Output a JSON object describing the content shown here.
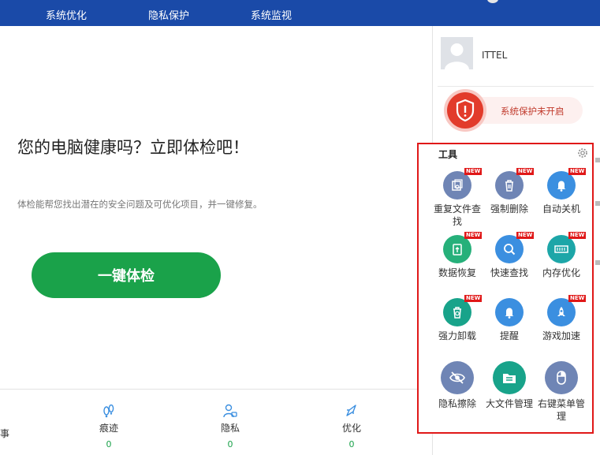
{
  "nav": {
    "tabs": [
      "系统优化",
      "隐私保护",
      "系统监视"
    ]
  },
  "main": {
    "headline": "您的电脑健康吗？立即体检吧！",
    "subtext": "体检能帮您找出潜在的安全问题及可优化项目，并一键修复。",
    "check_button": "一键体检",
    "stats": [
      {
        "label": "痕迹",
        "value": "0",
        "icon": "footprints-icon"
      },
      {
        "label": "隐私",
        "value": "0",
        "icon": "user-lock-icon"
      },
      {
        "label": "优化",
        "value": "0",
        "icon": "rocket-icon"
      }
    ],
    "edge_stat_fragment": "事"
  },
  "sidebar": {
    "username": "ITTEL",
    "protection_status": "系统保护未开启",
    "tools_title": "工具",
    "new_badge": "NEW",
    "tools": [
      {
        "name": "重复文件查找",
        "icon": "duplicate-file-icon",
        "color": "#6f85b5",
        "new": true
      },
      {
        "name": "强制删除",
        "icon": "trash-icon",
        "color": "#6f85b5",
        "new": true
      },
      {
        "name": "自动关机",
        "icon": "bell-icon",
        "color": "#3b8fe0",
        "new": true
      },
      {
        "name": "数据恢复",
        "icon": "data-recovery-icon",
        "color": "#26b07a",
        "new": true
      },
      {
        "name": "快速查找",
        "icon": "magnifier-icon",
        "color": "#3b8fe0",
        "new": true
      },
      {
        "name": "内存优化",
        "icon": "memory-icon",
        "color": "#1da6a8",
        "new": true
      },
      {
        "name": "强力卸载",
        "icon": "uninstall-icon",
        "color": "#18a38a",
        "new": true
      },
      {
        "name": "提醒",
        "icon": "bell-icon",
        "color": "#3b8fe0",
        "new": false
      },
      {
        "name": "游戏加速",
        "icon": "game-rocket-icon",
        "color": "#3b8fe0",
        "new": true
      },
      {
        "name": "隐私擦除",
        "icon": "eye-slash-icon",
        "color": "#6f85b5",
        "new": false
      },
      {
        "name": "大文件管理",
        "icon": "folder-list-icon",
        "color": "#18a38a",
        "new": false
      },
      {
        "name": "右键菜单管理",
        "icon": "mouse-icon",
        "color": "#6f85b5",
        "new": false
      }
    ]
  }
}
